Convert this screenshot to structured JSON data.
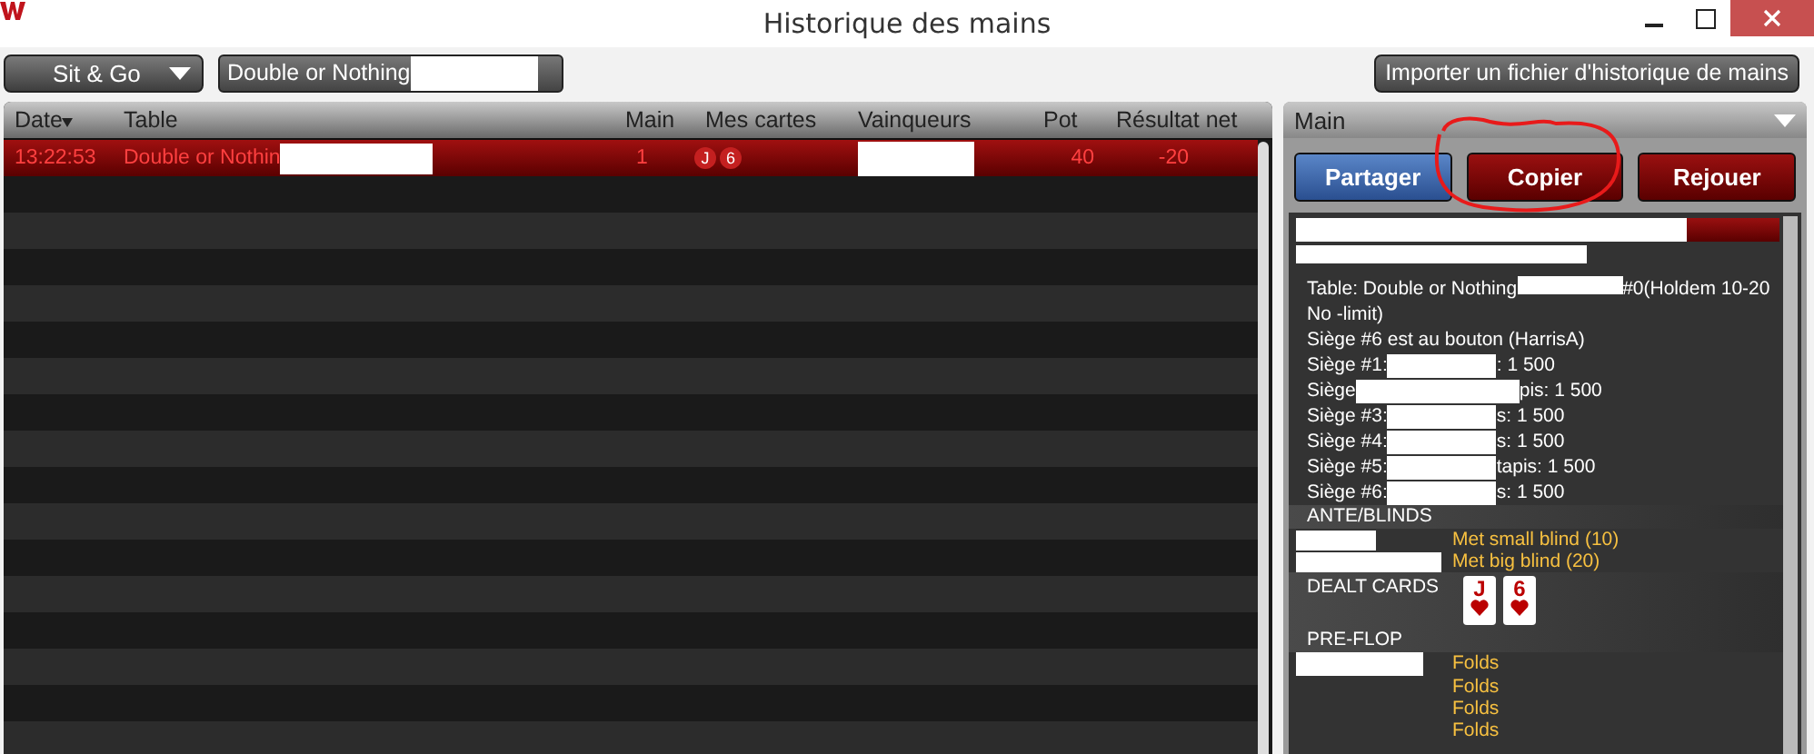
{
  "window": {
    "title": "Historique des mains"
  },
  "toolbar": {
    "game_type": "Sit & Go",
    "table_filter": "Double or Nothing",
    "import_button": "Importer un fichier d'historique de mains"
  },
  "table": {
    "columns": [
      {
        "label": "Date",
        "sorted": true
      },
      {
        "label": "Table",
        "sorted": false
      },
      {
        "label": "Main",
        "sorted": false
      },
      {
        "label": "Mes cartes",
        "sorted": false
      },
      {
        "label": "Vainqueurs",
        "sorted": false
      },
      {
        "label": "Pot",
        "sorted": false
      },
      {
        "label": "Résultat net",
        "sorted": false
      }
    ],
    "rows": [
      {
        "date": "13:22:53",
        "table": "Double or Nothin",
        "main": "1",
        "cards": [
          "J",
          "6"
        ],
        "pot": "40",
        "result": "-20",
        "selected": true
      }
    ]
  },
  "hand_panel": {
    "title": "Main",
    "buttons": [
      {
        "label": "Partager",
        "kind": "share"
      },
      {
        "label": "Copier",
        "kind": "action"
      },
      {
        "label": "Rejouer",
        "kind": "action"
      }
    ],
    "table_line": {
      "before": "Table: Double or Nothing",
      "after": "#0(Holdem 10-20 No -limit)"
    },
    "button_line": "Siège #6 est au bouton (HarrisA)",
    "seats": [
      {
        "before": "Siège #1:",
        "after": ": 1 500"
      },
      {
        "before": "Siège",
        "after": "pis: 1 500"
      },
      {
        "before": "Siège #3:",
        "after": "s: 1 500"
      },
      {
        "before": "Siège #4:",
        "after": "s: 1 500"
      },
      {
        "before": "Siège #5:",
        "after": "tapis: 1 500"
      },
      {
        "before": "Siège #6:",
        "after": "s: 1 500"
      }
    ],
    "sections": [
      {
        "title": "ANTE/BLINDS",
        "actions": [
          "Met small blind (10)",
          "Met big blind (20)"
        ]
      },
      {
        "title": "DEALT CARDS",
        "cards": [
          {
            "rank": "J"
          },
          {
            "rank": "6"
          }
        ]
      },
      {
        "title": "PRE-FLOP",
        "actions": [
          "Folds",
          "Folds",
          "Folds",
          "Folds"
        ]
      }
    ]
  },
  "annotation": {
    "kind": "circle"
  }
}
